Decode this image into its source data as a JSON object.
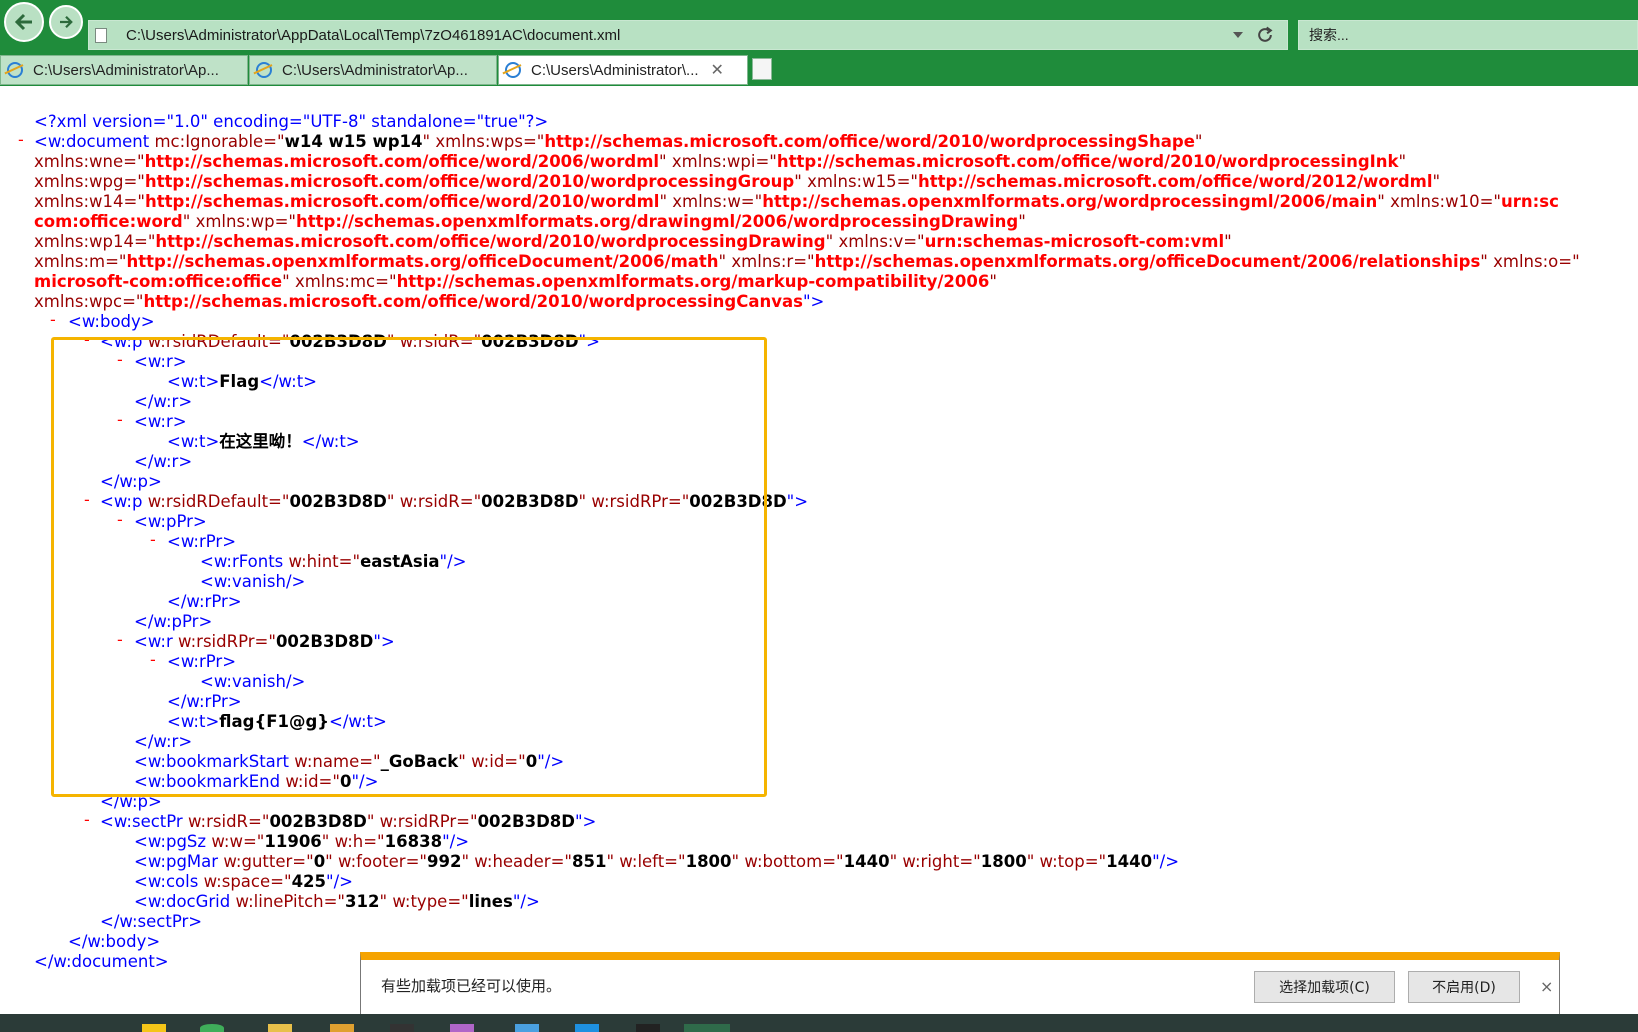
{
  "browser": {
    "address": "C:\\Users\\Administrator\\AppData\\Local\\Temp\\7zO461891AC\\document.xml",
    "search_placeholder": "搜索...",
    "tabs": [
      {
        "label": "C:\\Users\\Administrator\\Ap...",
        "active": false
      },
      {
        "label": "C:\\Users\\Administrator\\Ap...",
        "active": false
      },
      {
        "label": "C:\\Users\\Administrator\\...",
        "active": true
      }
    ],
    "tab_close": "✕",
    "accent_color": "#1f8c3b"
  },
  "xml": {
    "l1": {
      "open": "<?xml version=\"1.0\" encoding=\"UTF-8\" standalone=\"true\"?>"
    },
    "l2": {
      "t1": "<w:document ",
      "a1": "mc:Ignorable=\"",
      "v1": "w14 w15 wp14",
      "q1": "\" ",
      "a2": "xmlns:wps=\"",
      "v2": "http://schemas.microsoft.com/office/word/2010/wordprocessingShape",
      "q2": "\""
    },
    "l3": {
      "a1": "xmlns:wne=\"",
      "v1": "http://schemas.microsoft.com/office/word/2006/wordml",
      "q1": "\" ",
      "a2": "xmlns:wpi=\"",
      "v2": "http://schemas.microsoft.com/office/word/2010/wordprocessingInk",
      "q2": "\""
    },
    "l4": {
      "a1": "xmlns:wpg=\"",
      "v1": "http://schemas.microsoft.com/office/word/2010/wordprocessingGroup",
      "q1": "\" ",
      "a2": "xmlns:w15=\"",
      "v2": "http://schemas.microsoft.com/office/word/2012/wordml",
      "q2": "\""
    },
    "l5": {
      "a1": "xmlns:w14=\"",
      "v1": "http://schemas.microsoft.com/office/word/2010/wordml",
      "q1": "\" ",
      "a2": "xmlns:w=\"",
      "v2": "http://schemas.openxmlformats.org/wordprocessingml/2006/main",
      "q2": "\" ",
      "a3": "xmlns:w10=\"",
      "v3": "urn:sc"
    },
    "l6": {
      "v1": "com:office:word",
      "q1": "\" ",
      "a2": "xmlns:wp=\"",
      "v2": "http://schemas.openxmlformats.org/drawingml/2006/wordprocessingDrawing",
      "q2": "\""
    },
    "l7": {
      "a1": "xmlns:wp14=\"",
      "v1": "http://schemas.microsoft.com/office/word/2010/wordprocessingDrawing",
      "q1": "\" ",
      "a2": "xmlns:v=\"",
      "v2": "urn:schemas-microsoft-com:vml",
      "q2": "\""
    },
    "l8": {
      "a1": "xmlns:m=\"",
      "v1": "http://schemas.openxmlformats.org/officeDocument/2006/math",
      "q1": "\" ",
      "a2": "xmlns:r=\"",
      "v2": "http://schemas.openxmlformats.org/officeDocument/2006/relationships",
      "q2": "\" ",
      "a3": "xmlns:o=\""
    },
    "l9": {
      "v1": "microsoft-com:office:office",
      "q1": "\" ",
      "a2": "xmlns:mc=\"",
      "v2": "http://schemas.openxmlformats.org/markup-compatibility/2006",
      "q2": "\""
    },
    "l10": {
      "a1": "xmlns:wpc=\"",
      "v1": "http://schemas.microsoft.com/office/word/2010/wordprocessingCanvas",
      "q1": "\">"
    },
    "l11": {
      "t": "<w:body>"
    },
    "l12": {
      "t": "<w:p ",
      "a1": "w:rsidRDefault=\"",
      "v1": "002B3D8D",
      "q1": "\" ",
      "a2": "w:rsidR=\"",
      "v2": "002B3D8D",
      "q2": "\">"
    },
    "l13": {
      "t": "<w:r>"
    },
    "l14": {
      "t1": "<w:t>",
      "txt": "Flag",
      "t2": "</w:t>"
    },
    "l15": {
      "t": "</w:r>"
    },
    "l16": {
      "t": "<w:r>"
    },
    "l17": {
      "t1": "<w:t>",
      "txt": "在这里呦！",
      "t2": "</w:t>"
    },
    "l18": {
      "t": "</w:r>"
    },
    "l19": {
      "t": "</w:p>"
    },
    "l20": {
      "t": "<w:p ",
      "a1": "w:rsidRDefault=\"",
      "v1": "002B3D8D",
      "q1": "\" ",
      "a2": "w:rsidR=\"",
      "v2": "002B3D8D",
      "q2": "\" ",
      "a3": "w:rsidRPr=\"",
      "v3": "002B3D8D",
      "q3": "\">"
    },
    "l21": {
      "t": "<w:pPr>"
    },
    "l22": {
      "t": "<w:rPr>"
    },
    "l23": {
      "t": "<w:rFonts ",
      "a1": "w:hint=\"",
      "v1": "eastAsia",
      "q1": "\"/>"
    },
    "l24": {
      "t": "<w:vanish/>"
    },
    "l25": {
      "t": "</w:rPr>"
    },
    "l26": {
      "t": "</w:pPr>"
    },
    "l27": {
      "t": "<w:r ",
      "a1": "w:rsidRPr=\"",
      "v1": "002B3D8D",
      "q1": "\">"
    },
    "l28": {
      "t": "<w:rPr>"
    },
    "l29": {
      "t": "<w:vanish/>"
    },
    "l30": {
      "t": "</w:rPr>"
    },
    "l31": {
      "t1": "<w:t>",
      "txt": "flag{F1@g}",
      "t2": "</w:t>"
    },
    "l32": {
      "t": "</w:r>"
    },
    "l33": {
      "t": "<w:bookmarkStart ",
      "a1": "w:name=\"",
      "v1": "_GoBack",
      "q1": "\" ",
      "a2": "w:id=\"",
      "v2": "0",
      "q2": "\"/>"
    },
    "l34": {
      "t": "<w:bookmarkEnd ",
      "a1": "w:id=\"",
      "v1": "0",
      "q1": "\"/>"
    },
    "l35": {
      "t": "</w:p>"
    },
    "l36": {
      "t": "<w:sectPr ",
      "a1": "w:rsidR=\"",
      "v1": "002B3D8D",
      "q1": "\" ",
      "a2": "w:rsidRPr=\"",
      "v2": "002B3D8D",
      "q2": "\">"
    },
    "l37": {
      "t": "<w:pgSz ",
      "a1": "w:w=\"",
      "v1": "11906",
      "q1": "\" ",
      "a2": "w:h=\"",
      "v2": "16838",
      "q2": "\"/>"
    },
    "l38": {
      "t": "<w:pgMar ",
      "a1": "w:gutter=\"",
      "v1": "0",
      "q1": "\" ",
      "a2": "w:footer=\"",
      "v2": "992",
      "q2": "\" ",
      "a3": "w:header=\"",
      "v3": "851",
      "q3": "\" ",
      "a4": "w:left=\"",
      "v4": "1800",
      "q4": "\" ",
      "a5": "w:bottom=\"",
      "v5": "1440",
      "q5": "\" ",
      "a6": "w:right=\"",
      "v6": "1800",
      "q6": "\" ",
      "a7": "w:top=\"",
      "v7": "1440",
      "q7": "\"/>"
    },
    "l39": {
      "t": "<w:cols ",
      "a1": "w:space=\"",
      "v1": "425",
      "q1": "\"/>"
    },
    "l40": {
      "t": "<w:docGrid ",
      "a1": "w:linePitch=\"",
      "v1": "312",
      "q1": "\" ",
      "a2": "w:type=\"",
      "v2": "lines",
      "q2": "\"/>"
    },
    "l41": {
      "t": "</w:sectPr>"
    },
    "l42": {
      "t": "</w:body>"
    },
    "l43": {
      "t": "</w:document>"
    },
    "collapse_marker": "-"
  },
  "notification": {
    "message": "有些加载项已经可以使用。",
    "choose_button": "选择加载项(C)",
    "disable_button": "不启用(D)",
    "close": "×"
  }
}
